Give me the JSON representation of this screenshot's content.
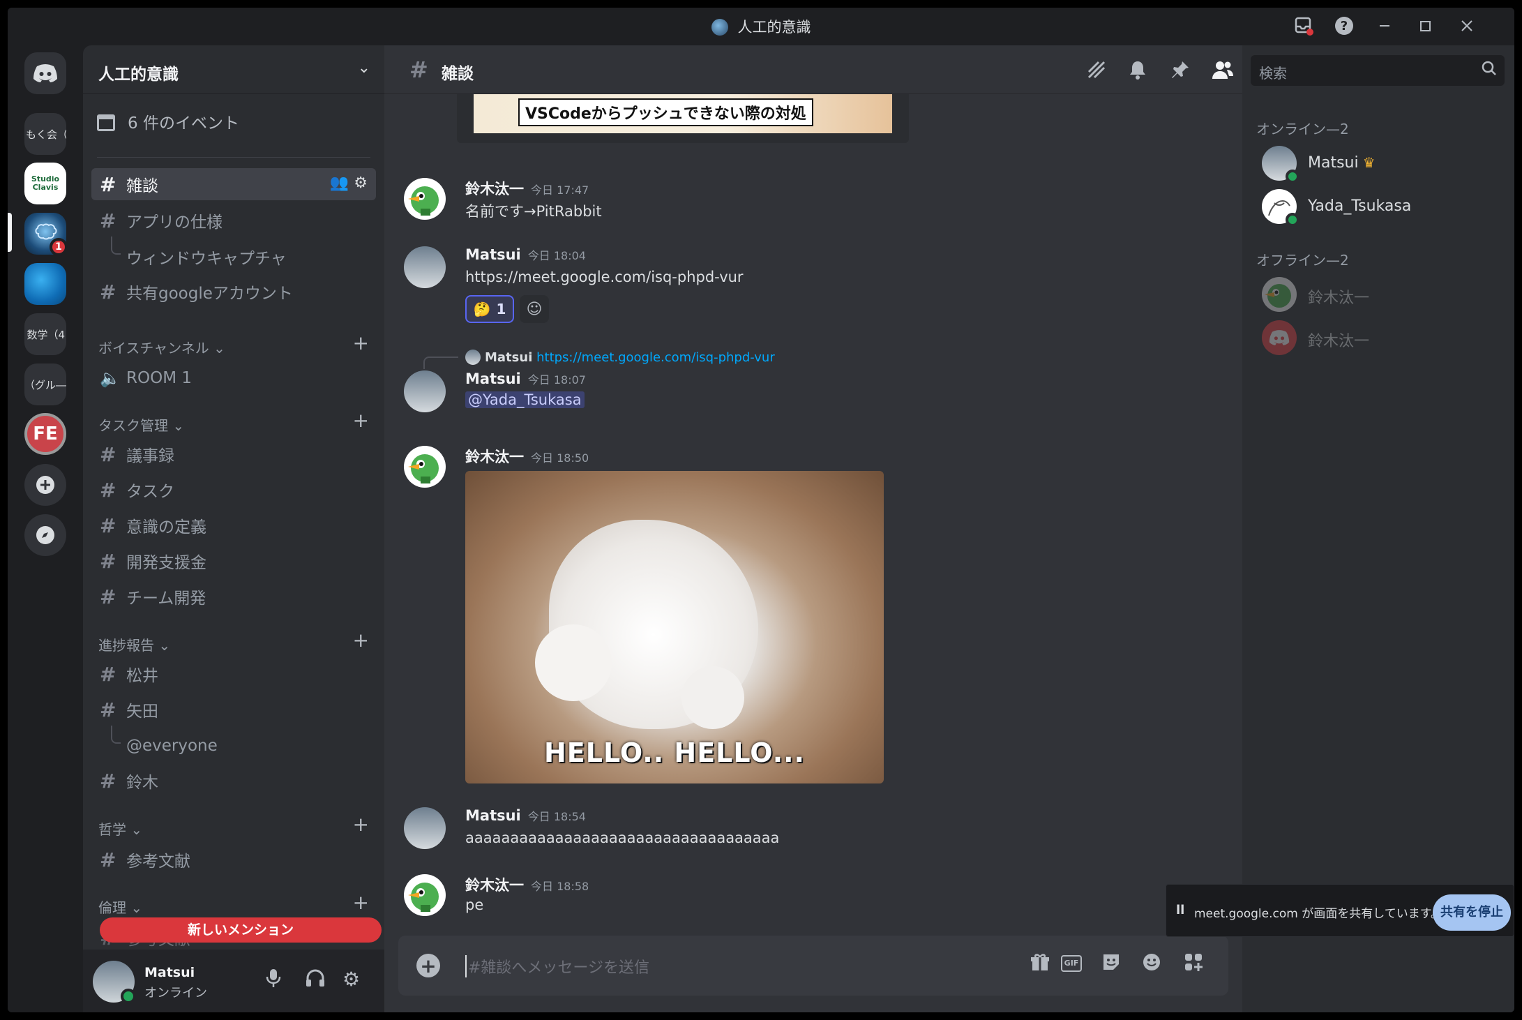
{
  "window": {
    "title": "人工的意識"
  },
  "servers": {
    "items": [
      {
        "label": "もく会（"
      },
      {
        "label": "Studio Clavis"
      },
      {
        "label": "",
        "badge": "1"
      },
      {
        "label": ""
      },
      {
        "label": "数学（4"
      },
      {
        "label": "（グル―"
      },
      {
        "label": "FE"
      }
    ]
  },
  "sidebar": {
    "guild_name": "人工的意識",
    "events": "6 件のイベント",
    "channels": [
      {
        "name": "雑談"
      },
      {
        "name": "アプリの仕様"
      },
      {
        "name": "ウィンドウキャプチャ"
      },
      {
        "name": "共有googleアカウント"
      }
    ],
    "voice_category": "ボイスチャンネル ⌄",
    "voice_room": "ROOM 1",
    "task_category": "タスク管理 ⌄",
    "task_channels": [
      {
        "name": "議事録"
      },
      {
        "name": "タスク"
      },
      {
        "name": "意識の定義"
      },
      {
        "name": "開発支援金"
      },
      {
        "name": "チーム開発"
      }
    ],
    "progress_category": "進捗報告 ⌄",
    "progress_channels": [
      {
        "name": "松井"
      },
      {
        "name": "矢田"
      }
    ],
    "progress_thread": "@everyone",
    "progress_channel_3": "鈴木",
    "philosophy_category": "哲学 ⌄",
    "philosophy_channel": "参考文献",
    "ethics_category": "倫理 ⌄",
    "ethics_channel": "参考文献",
    "new_mention": "新しいメンション"
  },
  "user_panel": {
    "name": "Matsui",
    "status": "オンライン"
  },
  "channel_header": {
    "name": "雑談"
  },
  "messages": {
    "embed_text": "VSCodeからプッシュできない際の対処",
    "m1": {
      "author": "鈴木汰一",
      "time": "今日 17:47",
      "text": "名前です→PitRabbit"
    },
    "m2": {
      "author": "Matsui",
      "time": "今日 18:04",
      "link": "https://meet.google.com/isq-phpd-vur",
      "reaction_emoji": "🤔",
      "reaction_count": "1"
    },
    "m3": {
      "reply_author": "Matsui",
      "reply_link": "https://meet.google.com/isq-phpd-vur",
      "author": "Matsui",
      "time": "今日 18:07",
      "mention": "@Yada_Tsukasa"
    },
    "m4": {
      "author": "鈴木汰一",
      "time": "今日 18:50",
      "gif_caption": "HELLO.. HELLO..."
    },
    "m5": {
      "author": "Matsui",
      "time": "今日 18:54",
      "text": "aaaaaaaaaaaaaaaaaaaaaaaaaaaaaaaaaaa"
    },
    "m6": {
      "author": "鈴木汰一",
      "time": "今日 18:58",
      "text": "pe"
    }
  },
  "composer": {
    "placeholder": "#雑談へメッセージを送信"
  },
  "members": {
    "search_placeholder": "検索",
    "online_header": "オンライン—2",
    "online": [
      {
        "name": "Matsui"
      },
      {
        "name": "Yada_Tsukasa"
      }
    ],
    "offline_header": "オフライン—2",
    "offline": [
      {
        "name": "鈴木汰一"
      },
      {
        "name": "鈴木汰一"
      }
    ]
  },
  "screen_share": {
    "text": "meet.google.com が画面を共有しています。",
    "stop_label": "共有を停止"
  },
  "colors": {
    "accent": "#5865f2",
    "online": "#23a559",
    "danger": "#da373c",
    "link": "#00a8fc"
  }
}
